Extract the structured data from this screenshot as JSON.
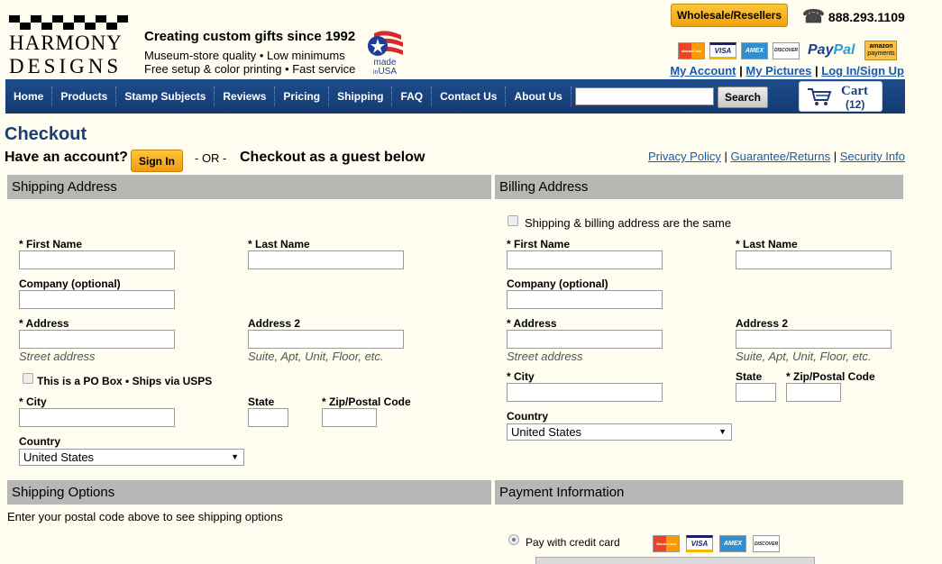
{
  "logo": {
    "line1": "HARMONY",
    "line2": "DESIGNS"
  },
  "tagline": {
    "title": "Creating custom gifts since 1992",
    "line2": "Museum-store quality • Low minimums",
    "line3": "Free setup & color printing • Fast service"
  },
  "made_usa": {
    "text_made": "made",
    "text_in": "in",
    "text_usa": "USA"
  },
  "header": {
    "wholesale_label": "Wholesale/Resellers",
    "phone": "888.293.1109",
    "paypal_1": "Pay",
    "paypal_2": "Pal",
    "amazon_1": "amazon",
    "amazon_2": "payments",
    "card_labels": [
      "MasterCard",
      "VISA",
      "AMEX",
      "DISCOVER"
    ],
    "account_links": [
      "My Account",
      "My Pictures",
      "Log In/Sign Up"
    ],
    "link_separator": "|"
  },
  "nav": {
    "items": [
      "Home",
      "Products",
      "Stamp Subjects",
      "Reviews",
      "Pricing",
      "Shipping",
      "FAQ",
      "Contact Us",
      "About Us"
    ],
    "search_value": "",
    "search_button": "Search",
    "cart_label": "Cart",
    "cart_count": "(12)"
  },
  "checkout": {
    "title": "Checkout",
    "have_account": "Have an account?",
    "sign_in": "Sign In",
    "or": "- OR -",
    "guest": "Checkout as a guest below",
    "policy_links": [
      "Privacy Policy",
      "Guarantee/Returns",
      "Security Info"
    ]
  },
  "shipping": {
    "heading": "Shipping Address",
    "first_name": "* First Name",
    "last_name": "* Last Name",
    "company": "Company (optional)",
    "address": "* Address",
    "address2": "Address 2",
    "address_hint": "Street address",
    "address2_hint": "Suite, Apt, Unit, Floor, etc.",
    "po_box": "This is a PO Box • Ships via USPS",
    "city": "* City",
    "state": "State",
    "zip": "* Zip/Postal Code",
    "country": "Country",
    "country_value": "United States"
  },
  "billing": {
    "heading": "Billing Address",
    "same_as": "Shipping & billing address are the same",
    "first_name": "* First Name",
    "last_name": "* Last Name",
    "company": "Company (optional)",
    "address": "* Address",
    "address2": "Address 2",
    "address_hint": "Street address",
    "address2_hint": "Suite, Apt, Unit, Floor, etc.",
    "city": "* City",
    "state": "State",
    "zip": "* Zip/Postal Code",
    "country": "Country",
    "country_value": "United States"
  },
  "shipping_options": {
    "heading": "Shipping Options",
    "note": "Enter your postal code above to see shipping options"
  },
  "payment": {
    "heading": "Payment Information",
    "pay_credit": "Pay with credit card"
  },
  "colors": {
    "nav_bg": "#1d4c8c",
    "accent_button": "#f2a10f",
    "link": "#1b5aa8",
    "section_header": "#b7b7b5",
    "page_bg": "#fefdf0"
  }
}
